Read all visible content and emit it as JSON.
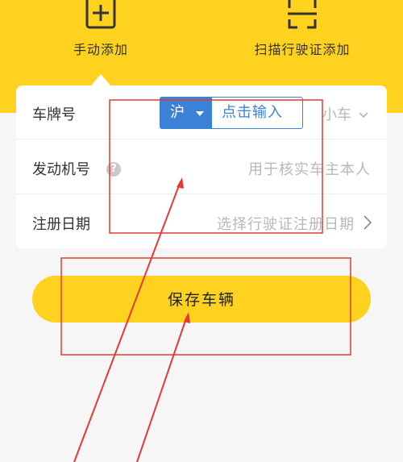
{
  "header": {
    "manual_label": "手动添加",
    "scan_label": "扫描行驶证添加"
  },
  "form": {
    "plate_label": "车牌号",
    "plate_province": "沪",
    "plate_placeholder": "点击输入",
    "car_type": "小车",
    "engine_label": "发动机号",
    "engine_help": "?",
    "engine_placeholder": "用于核实车主本人",
    "reg_label": "注册日期",
    "reg_placeholder": "选择行驶证注册日期"
  },
  "actions": {
    "save_label": "保存车辆"
  },
  "colors": {
    "brand": "#ffd21f",
    "input_accent": "#3b82d6",
    "annotation": "#e53935"
  }
}
